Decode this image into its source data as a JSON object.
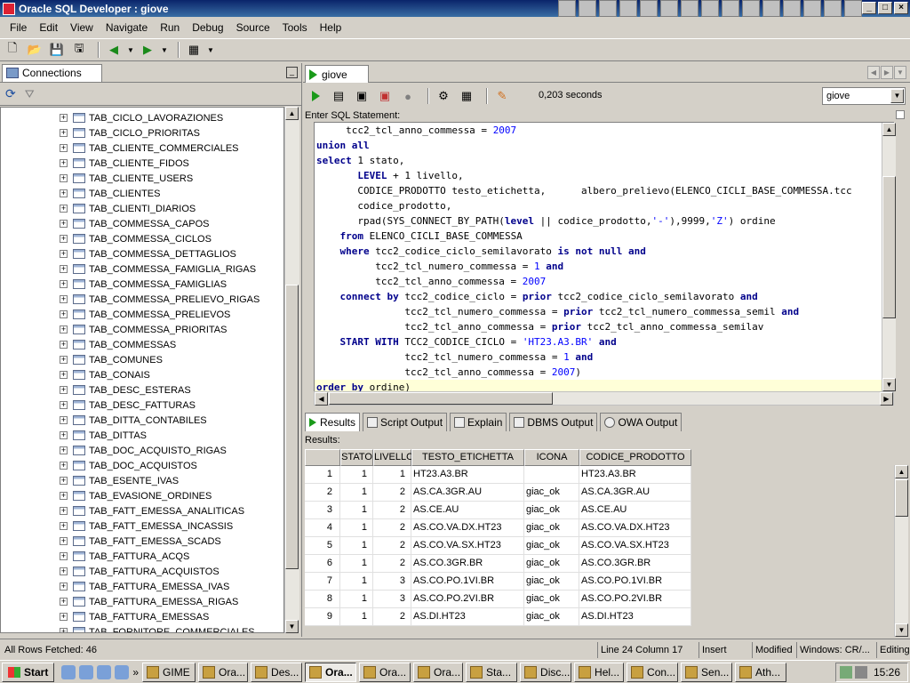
{
  "window": {
    "title": "Oracle SQL Developer : giove"
  },
  "menu": [
    "File",
    "Edit",
    "View",
    "Navigate",
    "Run",
    "Debug",
    "Source",
    "Tools",
    "Help"
  ],
  "left_panel": {
    "tab_label": "Connections",
    "tree_items": [
      "TAB_CICLO_LAVORAZIONES",
      "TAB_CICLO_PRIORITAS",
      "TAB_CLIENTE_COMMERCIALES",
      "TAB_CLIENTE_FIDOS",
      "TAB_CLIENTE_USERS",
      "TAB_CLIENTES",
      "TAB_CLIENTI_DIARIOS",
      "TAB_COMMESSA_CAPOS",
      "TAB_COMMESSA_CICLOS",
      "TAB_COMMESSA_DETTAGLIOS",
      "TAB_COMMESSA_FAMIGLIA_RIGAS",
      "TAB_COMMESSA_FAMIGLIAS",
      "TAB_COMMESSA_PRELIEVO_RIGAS",
      "TAB_COMMESSA_PRELIEVOS",
      "TAB_COMMESSA_PRIORITAS",
      "TAB_COMMESSAS",
      "TAB_COMUNES",
      "TAB_CONAIS",
      "TAB_DESC_ESTERAS",
      "TAB_DESC_FATTURAS",
      "TAB_DITTA_CONTABILES",
      "TAB_DITTAS",
      "TAB_DOC_ACQUISTO_RIGAS",
      "TAB_DOC_ACQUISTOS",
      "TAB_ESENTE_IVAS",
      "TAB_EVASIONE_ORDINES",
      "TAB_FATT_EMESSA_ANALITICAS",
      "TAB_FATT_EMESSA_INCASSIS",
      "TAB_FATT_EMESSA_SCADS",
      "TAB_FATTURA_ACQS",
      "TAB_FATTURA_ACQUISTOS",
      "TAB_FATTURA_EMESSA_IVAS",
      "TAB_FATTURA_EMESSA_RIGAS",
      "TAB_FATTURA_EMESSAS",
      "TAB_FORNITORE_COMMERCIALES"
    ]
  },
  "editor": {
    "tab_label": "giove",
    "exec_time": "0,203 seconds",
    "connection": "giove",
    "sql_label": "Enter SQL Statement:",
    "code_lines": [
      "     tcc2_tcl_anno_commessa = 2007",
      "union all",
      "select 1 stato,",
      "       LEVEL + 1 livello,",
      "       CODICE_PRODOTTO testo_etichetta,      albero_prelievo(ELENCO_CICLI_BASE_COMMESSA.tcc",
      "       codice_prodotto,",
      "       rpad(SYS_CONNECT_BY_PATH(level || codice_prodotto,'-'),9999,'Z') ordine",
      "    from ELENCO_CICLI_BASE_COMMESSA",
      "    where tcc2_codice_ciclo_semilavorato is not null and",
      "          tcc2_tcl_numero_commessa = 1 and",
      "          tcc2_tcl_anno_commessa = 2007",
      "    connect by tcc2_codice_ciclo = prior tcc2_codice_ciclo_semilavorato and",
      "               tcc2_tcl_numero_commessa = prior tcc2_tcl_numero_commessa_semil and",
      "               tcc2_tcl_anno_commessa = prior tcc2_tcl_anno_commessa_semilav",
      "    START WITH TCC2_CODICE_CICLO = 'HT23.A3.BR' and",
      "               tcc2_tcl_numero_commessa = 1 and",
      "               tcc2_tcl_anno_commessa = 2007)",
      "order by ordine)"
    ]
  },
  "results": {
    "tabs": [
      "Results",
      "Script Output",
      "Explain",
      "DBMS Output",
      "OWA Output"
    ],
    "label": "Results:",
    "columns": [
      "STATO",
      "LIVELLO",
      "TESTO_ETICHETTA",
      "ICONA",
      "CODICE_PRODOTTO"
    ],
    "rows": [
      [
        "1",
        "1",
        "1",
        "HT23.A3.BR",
        "",
        "HT23.A3.BR"
      ],
      [
        "2",
        "1",
        "2",
        "AS.CA.3GR.AU",
        "giac_ok",
        "AS.CA.3GR.AU"
      ],
      [
        "3",
        "1",
        "2",
        "AS.CE.AU",
        "giac_ok",
        "AS.CE.AU"
      ],
      [
        "4",
        "1",
        "2",
        "AS.CO.VA.DX.HT23",
        "giac_ok",
        "AS.CO.VA.DX.HT23"
      ],
      [
        "5",
        "1",
        "2",
        "AS.CO.VA.SX.HT23",
        "giac_ok",
        "AS.CO.VA.SX.HT23"
      ],
      [
        "6",
        "1",
        "2",
        "AS.CO.3GR.BR",
        "giac_ok",
        "AS.CO.3GR.BR"
      ],
      [
        "7",
        "1",
        "3",
        "AS.CO.PO.1VI.BR",
        "giac_ok",
        "AS.CO.PO.1VI.BR"
      ],
      [
        "8",
        "1",
        "3",
        "AS.CO.PO.2VI.BR",
        "giac_ok",
        "AS.CO.PO.2VI.BR"
      ],
      [
        "9",
        "1",
        "2",
        "AS.DI.HT23",
        "giac_ok",
        "AS.DI.HT23"
      ]
    ]
  },
  "status": {
    "rows_fetched": "All Rows Fetched: 46",
    "position": "Line 24 Column 17",
    "mode": "Insert",
    "modified": "Modified",
    "line_ending": "Windows: CR/...",
    "editing": "Editing"
  },
  "taskbar": {
    "start": "Start",
    "tasks": [
      "GIME",
      "Ora...",
      "Des...",
      "Ora...",
      "Ora...",
      "Ora...",
      "Sta...",
      "Disc...",
      "Hel...",
      "Con...",
      "Sen...",
      "Ath..."
    ],
    "active_index": 3,
    "clock": "15:26"
  }
}
